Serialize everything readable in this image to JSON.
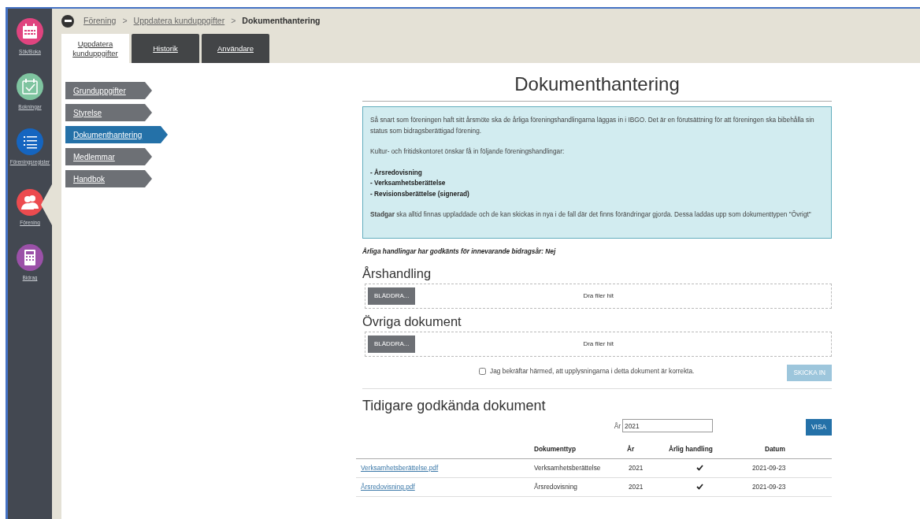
{
  "nav_rail": [
    {
      "label": "Sök/Boka",
      "color": "#e0447f",
      "selected": false
    },
    {
      "label": "Bokningar",
      "color": "#7fc4a0",
      "selected": false
    },
    {
      "label": "Föreningsregister",
      "color": "#1565c0",
      "selected": false
    },
    {
      "label": "Förening",
      "color": "#ec4b4f",
      "selected": true
    },
    {
      "label": "Bidrag",
      "color": "#9b51a8",
      "selected": false
    }
  ],
  "breadcrumb": [
    {
      "label": "Förening",
      "current": false
    },
    {
      "label": "Uppdatera kunduppgifter",
      "current": false
    },
    {
      "label": "Dokumenthantering",
      "current": true
    }
  ],
  "breadcrumb_separator": ">",
  "tabs": [
    {
      "label": "Uppdatera kunduppgifter",
      "selected": true
    },
    {
      "label": "Historik",
      "selected": false
    },
    {
      "label": "Användare",
      "selected": false
    }
  ],
  "side_menu": [
    {
      "label": "Grunduppgifter",
      "selected": false
    },
    {
      "label": "Styrelse",
      "selected": false
    },
    {
      "label": "Dokumenthantering",
      "selected": true
    },
    {
      "label": "Medlemmar",
      "selected": false
    },
    {
      "label": "Handbok",
      "selected": false
    }
  ],
  "main": {
    "title": "Dokumenthantering",
    "info_box": [
      {
        "kind": "paragraph",
        "text": "Så snart som föreningen haft sitt årsmöte ska de årliga föreningshandlingarna läggas in i IBGO. Det är en förutsättning för att föreningen ska bibehålla sin status som bidragsberättigad förening."
      },
      {
        "kind": "paragraph",
        "text": "Kultur- och fritidskontoret önskar få in följande föreningshandlingar:"
      },
      {
        "kind": "list",
        "items": [
          "- Årsredovisning",
          "- Verksamhetsberättelse",
          "- Revisionsberättelse (signerad)"
        ]
      },
      {
        "kind": "paragraph",
        "text": "**Stadgar** ska alltid finnas uppladdade och de kan skickas in nya i de fall där det finns förändringar gjorda. Dessa laddas upp som dokumenttypen \"Övrigt\""
      }
    ],
    "status_line": "Årliga handlingar har godkänts för innevarande bidragsår: Nej",
    "uploads": [
      {
        "heading": "Årshandling",
        "button": "BLÄDDRA...",
        "hint": "Dra filer hit"
      },
      {
        "heading": "Övriga dokument",
        "button": "BLÄDDRA...",
        "hint": "Dra filer hit"
      }
    ],
    "confirm": {
      "label": "Jag bekräftar härmed, att upplysningarna i detta dokument är korrekta.",
      "checked": false
    },
    "submit_button": {
      "label": "SKICKA IN",
      "disabled": true
    },
    "previous": {
      "title": "Tidigare godkända dokument",
      "year_label": "År",
      "year_value": "2021",
      "show_button": "VISA",
      "columns": [
        "Dokumenttyp",
        "År",
        "Årlig handling",
        "Datum"
      ],
      "rows": [
        {
          "file": "Verksamhetsberättelse.pdf",
          "type": "Verksamhetsberättelse",
          "year": "2021",
          "annual": true,
          "date": "2021-09-23"
        },
        {
          "file": "Årsredovisning.pdf",
          "type": "Årsredovisning",
          "year": "2021",
          "annual": true,
          "date": "2021-09-23"
        }
      ]
    }
  }
}
